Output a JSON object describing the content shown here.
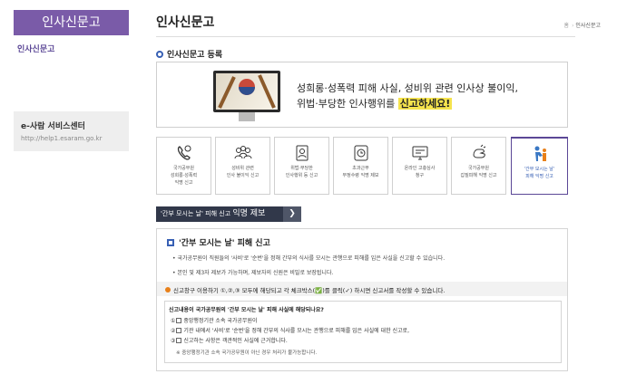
{
  "sidebar": {
    "title": "인사신문고",
    "items": [
      {
        "label": "인사신문고"
      }
    ],
    "service": {
      "title": "e-사람 서비스센터",
      "url": "http://help1.esaram.go.kr"
    }
  },
  "header": {
    "title": "인사신문고",
    "breadcrumb": {
      "home": "홈",
      "current": "인사신문고"
    }
  },
  "section": {
    "title": "인사신문고 등록"
  },
  "banner": {
    "line1": "성희롱·성폭력 피해 사실, 성비위 관련 인사상 불이익,",
    "line2_prefix": "위법·부당한 인사행위를",
    "highlight": "신고하세요!"
  },
  "categories": [
    {
      "line1": "국가공무원",
      "line2": "성희롱·성폭력",
      "line3": "익명 신고",
      "icon": "phone-icon"
    },
    {
      "line1": "성비위 관련",
      "line2": "인사 불이익 신고",
      "line3": "",
      "icon": "people-icon"
    },
    {
      "line1": "위법·부당한",
      "line2": "인사행위 등 신고",
      "line3": "",
      "icon": "id-card-icon"
    },
    {
      "line1": "초과근무",
      "line2": "부정수령 익명 제보",
      "line3": "",
      "icon": "clock-icon"
    },
    {
      "line1": "온라인 고충심사",
      "line2": "청구",
      "line3": "",
      "icon": "computer-icon"
    },
    {
      "line1": "국가공무원",
      "line2": "갑질피해 익명 신고",
      "line3": "",
      "icon": "hand-icon"
    },
    {
      "line1": "'간부 모시는 날'",
      "line2": "피해 익명 신고",
      "line3": "",
      "icon": "person-bow-icon",
      "active": true
    }
  ],
  "tab": {
    "prefix": "'간부 모시는 날' 피해 신고",
    "main": "익명 제보",
    "arrow": "❯"
  },
  "report": {
    "heading": "'간부 모시는 날' 피해 신고",
    "notes": [
      "국가공무원이 직원들의 '사비'로 '순번'을 정해 간부의 식사를 모시는 관행으로 피해를 입은 사실을 신고할 수 있습니다.",
      "본인 및 제3자 제보가 가능하며, 제보자의 신원은 비밀로 보장됩니다."
    ],
    "instruction": "신고창구 이용하기 ①,②,③ 모두에 해당되고 각 체크박스(✅)를 클릭(✓) 하시면 신고서를 작성할 수 있습니다.",
    "question": "신고내용이 국가공무원의 '간부 모시는 날' 피해 사실에 해당되나요?",
    "options": [
      {
        "num": "①",
        "text": "중앙행정기관 소속 국가공무원이"
      },
      {
        "num": "②",
        "text": "기관 내에서 '사비'로 '순번'을 정해 간부의 식사를 모시는 관행으로 피해를 입은 사실에 대한 신고로,"
      },
      {
        "num": "③",
        "text": "신고하는 사항은 객관적인 사실에 근거합니다."
      }
    ],
    "footnote": "※ 중앙행정기관 소속 국가공무원이 아닌 경우 처리가 불가능합니다."
  },
  "colors": {
    "sidebar": "#7a5ba8",
    "accent": "#3860b4",
    "tab": "#31384a",
    "highlight": "#f5e34d"
  }
}
